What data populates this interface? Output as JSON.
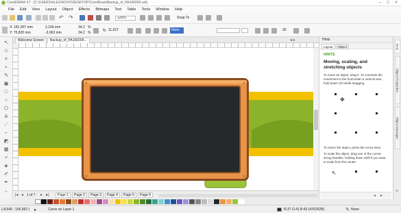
{
  "app": {
    "title": "CorelDRAW X7 - [C:\\USERS\\ALEX\\ROVO\\DESKTOP\\CorelDraw\\Backup_of_PA166009.cdr]",
    "logo_icon": "coreldraw-logo-icon"
  },
  "menu": [
    "File",
    "Edit",
    "View",
    "Layout",
    "Object",
    "Effects",
    "Bitmaps",
    "Text",
    "Table",
    "Tools",
    "Window",
    "Help"
  ],
  "toolbar": {
    "zoom_value": "125%",
    "snap_to_label": "Snap To",
    "pos_x": "X: 181,007 mm",
    "pos_y": "Y: 75,820 mm",
    "width": "2,166 mm",
    "height": "-3,063 mm",
    "scale_x": "34,2",
    "scale_y": "34,2",
    "pct_x": "%",
    "pct_y": "%",
    "angle": "11,627",
    "outline_label": "None",
    "outline_icon": "color-swatch-icon",
    "extra_value": "30"
  },
  "tabs": [
    "Welcome Screen",
    "Backup_of_PA166009..."
  ],
  "pages": {
    "counter": "1 of 7",
    "list": [
      "Page 1",
      "Page 2",
      "Page 3",
      "Page 4",
      "Page 5",
      "Page 6"
    ]
  },
  "hints": {
    "panel_title": "Hints",
    "tab_hints": "Layout",
    "tab_object": "Object",
    "section_label": "HINTS",
    "heading": "Moving, scaling, and stretching objects",
    "p1": "To move an object, drag it. To constrain the movement to the horizontal or vertical axis, hold down Ctrl while dragging.",
    "p2": "To resize the object, press the Arrow keys.",
    "p3": "To scale the object, drag one of the corner sizing handles, holding down Shift if you want to scale from the center."
  },
  "dockers": [
    "Hints",
    "Object Properties",
    "Object Manager"
  ],
  "status": {
    "coords": "(-8,640 ; 106,992 )",
    "layer": "Curve on Layer 1",
    "fill_info": "R:37 G:41 B:43 (#25292B)",
    "outline_info": "None"
  },
  "colors": {
    "board_fill": "#25292B",
    "frame": "#E8954A",
    "band_green": "#8DB32A",
    "band_yellow": "#F2C100"
  }
}
